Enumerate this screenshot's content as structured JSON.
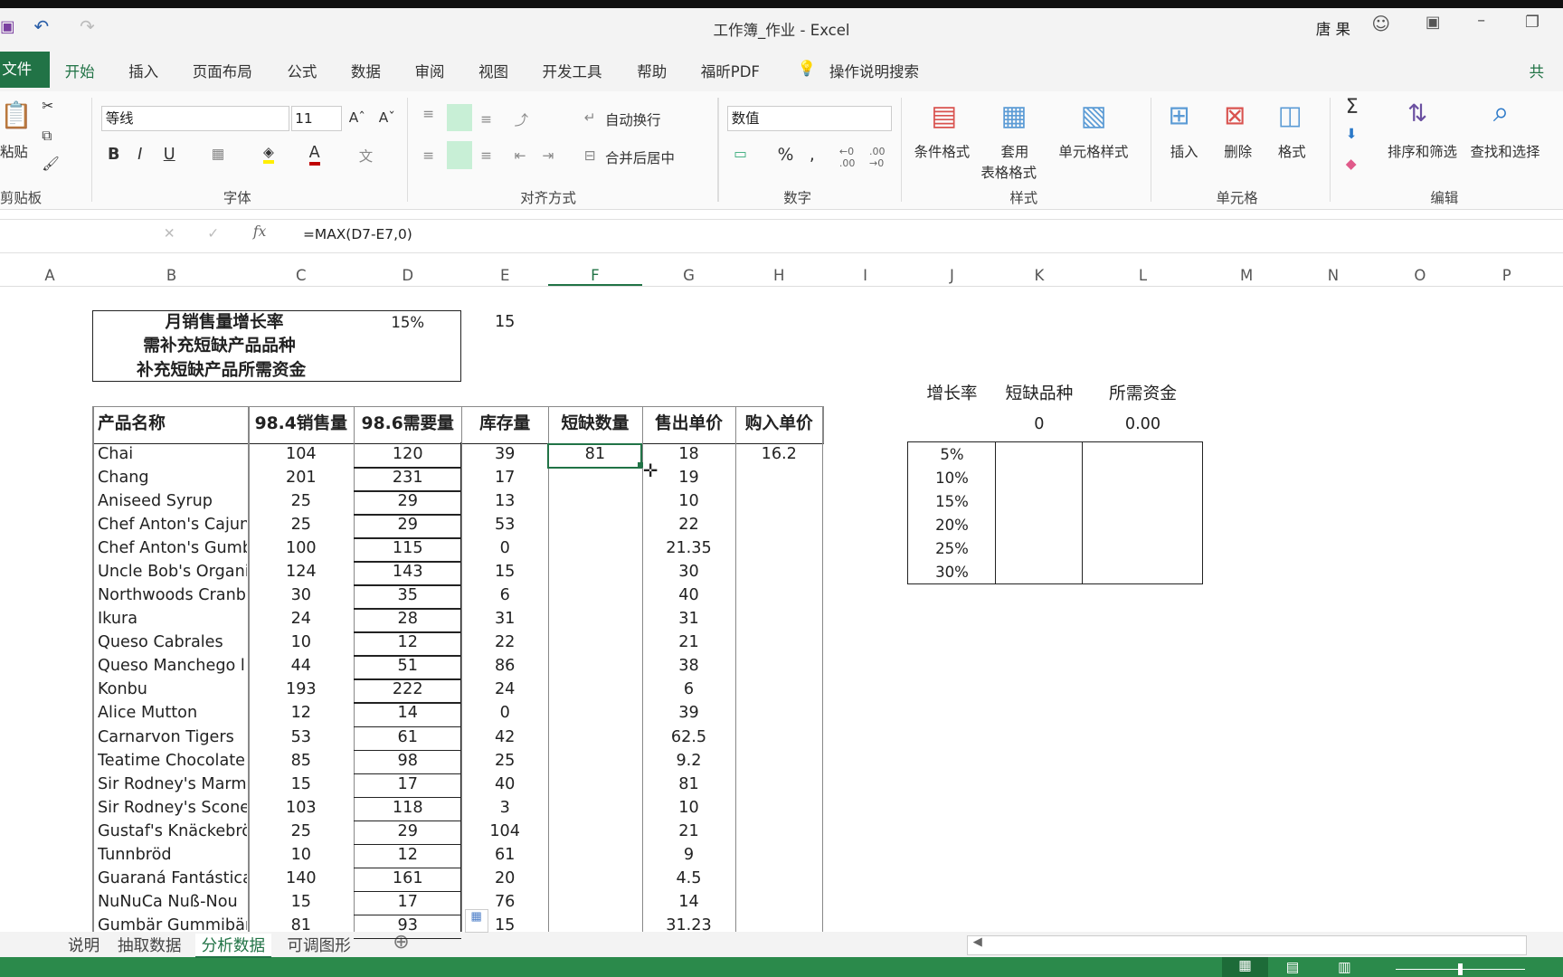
{
  "window": {
    "title": "工作簿_作业  -  Excel",
    "user": "唐 果"
  },
  "tabs": {
    "file": "文件",
    "items": [
      "开始",
      "插入",
      "页面布局",
      "公式",
      "数据",
      "审阅",
      "视图",
      "开发工具",
      "帮助",
      "福昕PDF"
    ],
    "search": "操作说明搜索",
    "share": "共"
  },
  "ribbon": {
    "paste": "粘贴",
    "clipboard": "剪贴板",
    "font_name": "等线",
    "font_size": "11",
    "font_group": "字体",
    "wrap": "自动换行",
    "merge": "合并后居中",
    "align_group": "对齐方式",
    "number_format": "数值",
    "number_group": "数字",
    "cond_format": "条件格式",
    "table_format_1": "套用",
    "table_format_2": "表格格式",
    "cell_style": "单元格样式",
    "styles_group": "样式",
    "insert": "插入",
    "delete": "删除",
    "format": "格式",
    "cells_group": "单元格",
    "sort": "排序和筛选",
    "find": "查找和选择",
    "edit_group": "编辑"
  },
  "formula_bar": {
    "fx": "fx",
    "formula": "=MAX(D7-E7,0)"
  },
  "columns": [
    "A",
    "B",
    "C",
    "D",
    "E",
    "F",
    "G",
    "H",
    "I",
    "J",
    "K",
    "L",
    "M",
    "N",
    "O",
    "P"
  ],
  "summary": {
    "growth_label": "月销售量增长率",
    "growth_value": "15%",
    "extra_value": "15",
    "need_label": "需补充短缺产品品种",
    "fund_label": "补充短缺产品所需资金"
  },
  "table": {
    "headers": [
      "产品名称",
      "98.4销售量",
      "98.6需要量",
      "库存量",
      "短缺数量",
      "售出单价",
      "购入单价"
    ],
    "rows": [
      [
        "Chai",
        "104",
        "120",
        "39",
        "81",
        "18",
        "16.2"
      ],
      [
        "Chang",
        "201",
        "231",
        "17",
        "",
        "19",
        ""
      ],
      [
        "Aniseed Syrup",
        "25",
        "29",
        "13",
        "",
        "10",
        ""
      ],
      [
        "Chef Anton's Cajun",
        "25",
        "29",
        "53",
        "",
        "22",
        ""
      ],
      [
        "Chef Anton's Gumb",
        "100",
        "115",
        "0",
        "",
        "21.35",
        ""
      ],
      [
        "Uncle Bob's Organi",
        "124",
        "143",
        "15",
        "",
        "30",
        ""
      ],
      [
        "Northwoods Cranb",
        "30",
        "35",
        "6",
        "",
        "40",
        ""
      ],
      [
        "Ikura",
        "24",
        "28",
        "31",
        "",
        "31",
        ""
      ],
      [
        "Queso Cabrales",
        "10",
        "12",
        "22",
        "",
        "21",
        ""
      ],
      [
        "Queso Manchego l",
        "44",
        "51",
        "86",
        "",
        "38",
        ""
      ],
      [
        "Konbu",
        "193",
        "222",
        "24",
        "",
        "6",
        ""
      ],
      [
        "Alice Mutton",
        "12",
        "14",
        "0",
        "",
        "39",
        ""
      ],
      [
        "Carnarvon Tigers",
        "53",
        "61",
        "42",
        "",
        "62.5",
        ""
      ],
      [
        "Teatime Chocolate",
        "85",
        "98",
        "25",
        "",
        "9.2",
        ""
      ],
      [
        "Sir Rodney's Marm",
        "15",
        "17",
        "40",
        "",
        "81",
        ""
      ],
      [
        "Sir Rodney's Scone",
        "103",
        "118",
        "3",
        "",
        "10",
        ""
      ],
      [
        "Gustaf's Knäckebrö",
        "25",
        "29",
        "104",
        "",
        "21",
        ""
      ],
      [
        "Tunnbröd",
        "10",
        "12",
        "61",
        "",
        "9",
        ""
      ],
      [
        "Guaraná Fantástica",
        "140",
        "161",
        "20",
        "",
        "4.5",
        ""
      ],
      [
        "NuNuCa Nuß-Nou",
        "15",
        "17",
        "76",
        "",
        "14",
        ""
      ],
      [
        "Gumbär Gummibär",
        "81",
        "93",
        "15",
        "",
        "31.23",
        ""
      ]
    ]
  },
  "scenario": {
    "headers": [
      "增长率",
      "短缺品种",
      "所需资金"
    ],
    "current": [
      "0",
      "0.00"
    ],
    "rates": [
      "5%",
      "10%",
      "15%",
      "20%",
      "25%",
      "30%"
    ]
  },
  "sheets": {
    "items": [
      "说明",
      "抽取数据",
      "分析数据",
      "可调图形"
    ],
    "active": 2
  },
  "colors": {
    "excel_green": "#217346",
    "status_green": "#2b8a4b",
    "selection": "#217346"
  }
}
